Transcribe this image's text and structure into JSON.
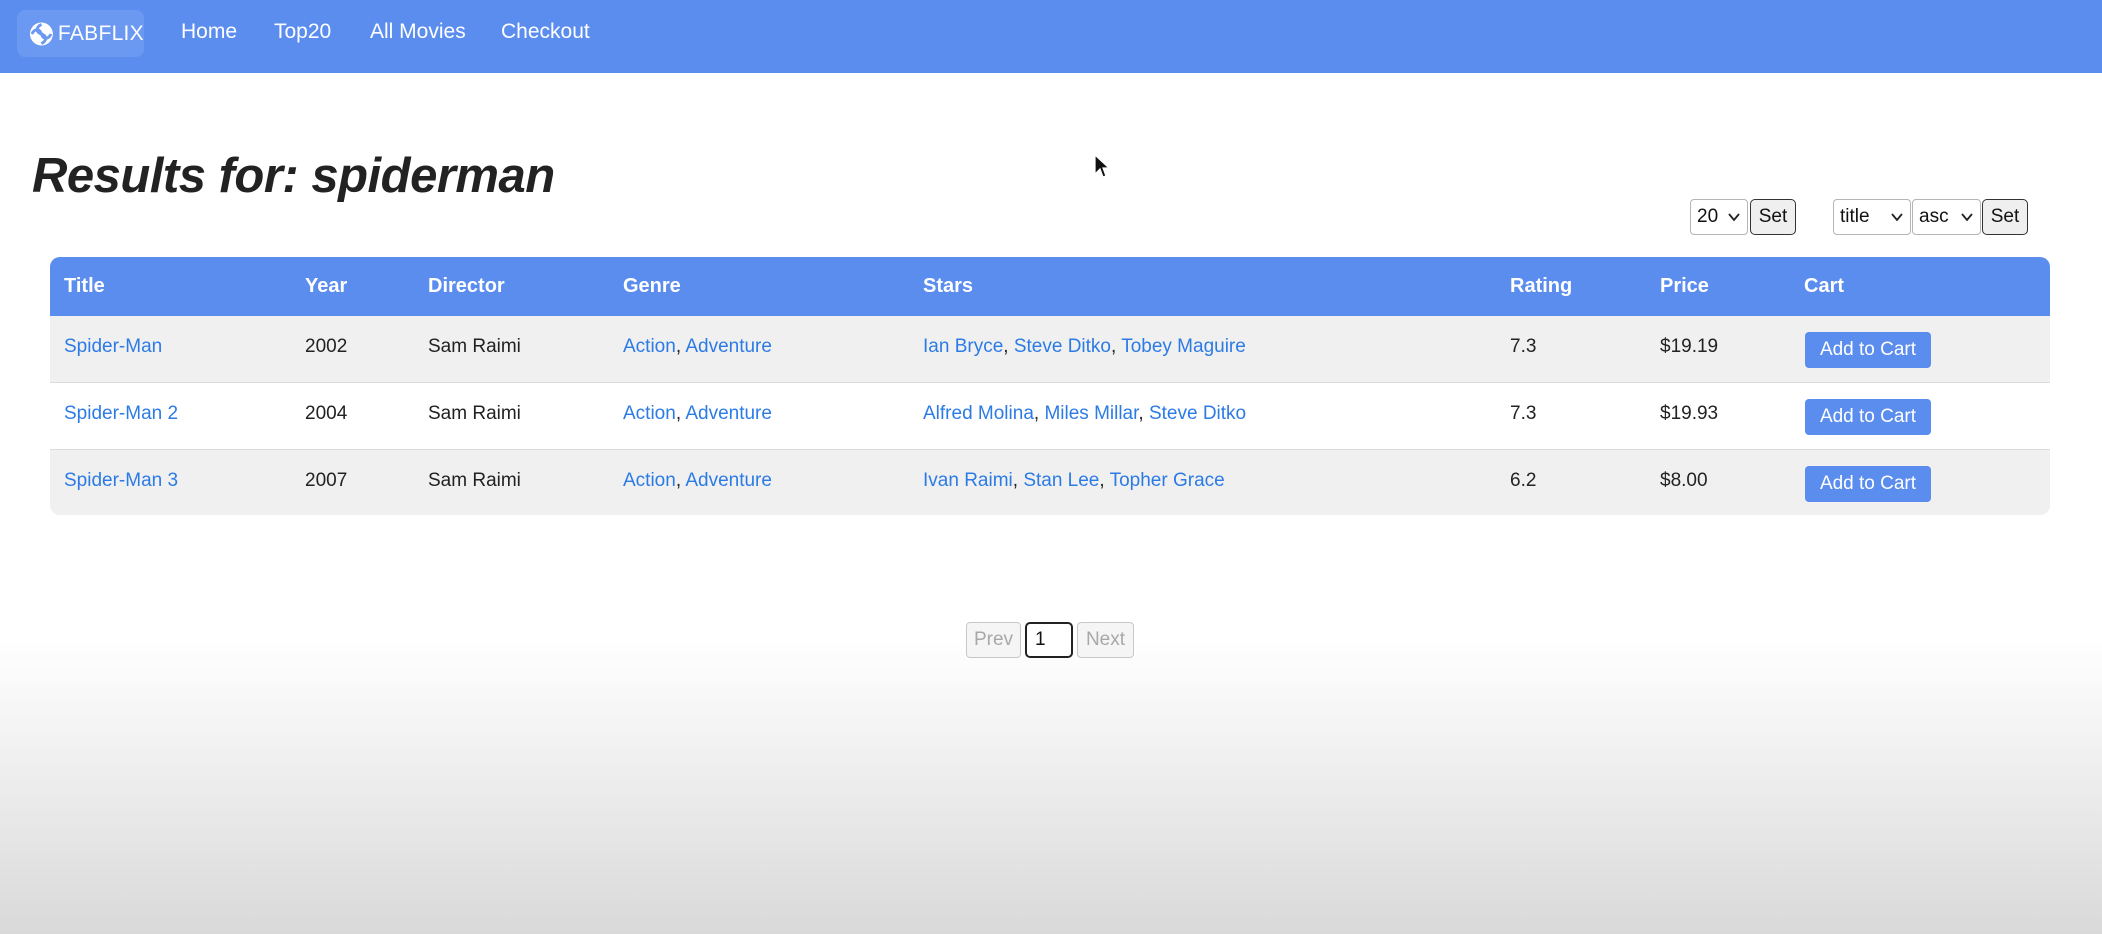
{
  "nav": {
    "brand": "FABFLIX",
    "links": [
      "Home",
      "Top20",
      "All Movies",
      "Checkout"
    ]
  },
  "page_title": "Results for: spiderman",
  "controls": {
    "page_size": "20",
    "set_label": "Set",
    "sort_field": "title",
    "sort_order": "asc"
  },
  "table": {
    "headers": [
      "Title",
      "Year",
      "Director",
      "Genre",
      "Stars",
      "Rating",
      "Price",
      "Cart"
    ],
    "rows": [
      {
        "title": "Spider-Man",
        "year": "2002",
        "director": "Sam Raimi",
        "genres": [
          "Action",
          "Adventure"
        ],
        "stars": [
          "Ian Bryce",
          "Steve Ditko",
          "Tobey Maguire"
        ],
        "rating": "7.3",
        "price": "$19.19",
        "cart": "Add to Cart"
      },
      {
        "title": "Spider-Man 2",
        "year": "2004",
        "director": "Sam Raimi",
        "genres": [
          "Action",
          "Adventure"
        ],
        "stars": [
          "Alfred Molina",
          "Miles Millar",
          "Steve Ditko"
        ],
        "rating": "7.3",
        "price": "$19.93",
        "cart": "Add to Cart"
      },
      {
        "title": "Spider-Man 3",
        "year": "2007",
        "director": "Sam Raimi",
        "genres": [
          "Action",
          "Adventure"
        ],
        "stars": [
          "Ivan Raimi",
          "Stan Lee",
          "Topher Grace"
        ],
        "rating": "6.2",
        "price": "$8.00",
        "cart": "Add to Cart"
      }
    ]
  },
  "pagination": {
    "prev": "Prev",
    "page": "1",
    "next": "Next"
  },
  "colors": {
    "accent": "#5b8def",
    "link": "#2c7be5"
  }
}
